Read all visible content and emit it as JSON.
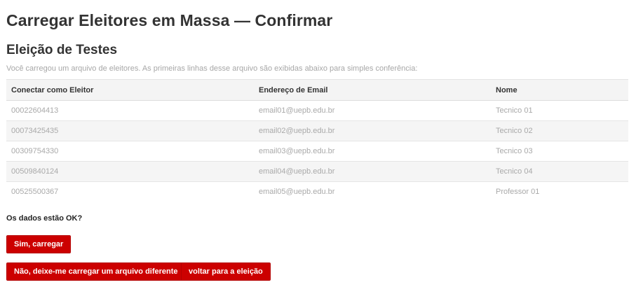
{
  "page": {
    "title": "Carregar Eleitores em Massa — Confirmar",
    "election_name": "Eleição de Testes",
    "intro": "Você carregou um arquivo de eleitores. As primeiras linhas desse arquivo são exibidas abaixo para simples conferência:"
  },
  "table": {
    "headers": [
      "Conectar como Eleitor",
      "Endereço de Email",
      "Nome"
    ],
    "rows": [
      [
        "00022604413",
        "email01@uepb.edu.br",
        "Tecnico 01"
      ],
      [
        "00073425435",
        "email02@uepb.edu.br",
        "Tecnico 02"
      ],
      [
        "00309754330",
        "email03@uepb.edu.br",
        "Tecnico 03"
      ],
      [
        "00509840124",
        "email04@uepb.edu.br",
        "Tecnico 04"
      ],
      [
        "00525500367",
        "email05@uepb.edu.br",
        "Professor 01"
      ]
    ]
  },
  "confirm": {
    "question": "Os dados estão OK?",
    "yes_label": "Sim, carregar",
    "other_file_label": "Não, deixe-me carregar um arquivo diferente",
    "back_label": "voltar para a eleição"
  },
  "colors": {
    "accent": "#cc0000",
    "muted_text": "#a9a9a9",
    "heading_text": "#333333"
  }
}
